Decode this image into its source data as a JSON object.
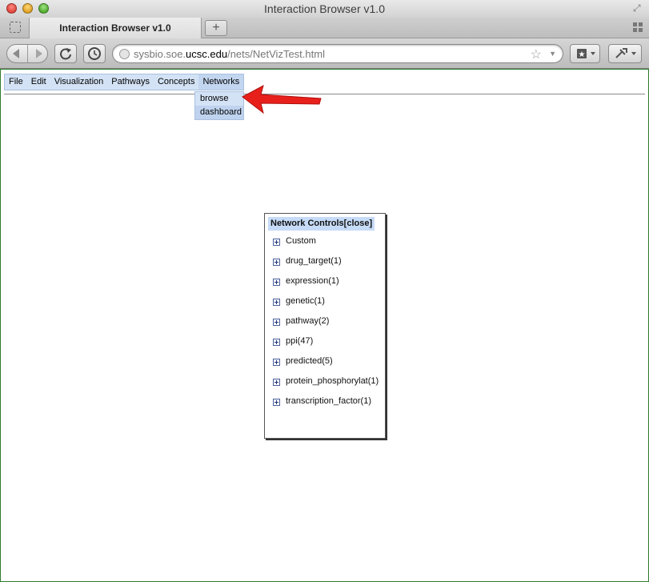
{
  "window": {
    "title": "Interaction Browser v1.0"
  },
  "tab": {
    "label": "Interaction Browser v1.0",
    "new_tab_label": "+"
  },
  "url_bar": {
    "prefix": "sysbio.soe.",
    "host": "ucsc.edu",
    "path": "/nets/NetVizTest.html"
  },
  "menu": {
    "items": [
      "File",
      "Edit",
      "Visualization",
      "Pathways",
      "Concepts",
      "Networks"
    ],
    "open_index": 5,
    "dropdown": [
      "browse",
      "dashboard"
    ]
  },
  "panel": {
    "title": "Network Controls[close]",
    "nodes": [
      "Custom",
      "drug_target(1)",
      "expression(1)",
      "genetic(1)",
      "pathway(2)",
      "ppi(47)",
      "predicted(5)",
      "protein_phosphorylat(1)",
      "transcription_factor(1)"
    ]
  },
  "colors": {
    "menu_bg": "#d3e2f5",
    "panel_header_bg": "#c6dbf7",
    "arrow": "#e8201c"
  }
}
